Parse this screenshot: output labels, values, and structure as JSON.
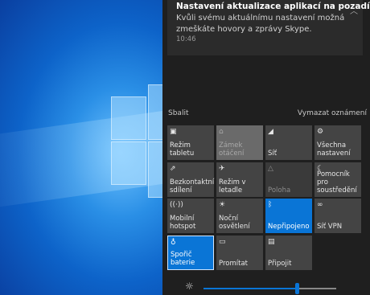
{
  "notification": {
    "title": "Nastavení aktualizace aplikací na pozadí",
    "body": "Kvůli svému aktuálnímu nastavení možná zmeškáte hovory a zprávy Skype.",
    "time": "10:46"
  },
  "collapse_label": "Sbalit",
  "clear_label": "Vymazat oznámení",
  "tiles": [
    {
      "label": "Režim tabletu",
      "icon": "tablet-icon",
      "state": "off"
    },
    {
      "label": "Zámek otáčení",
      "icon": "rotation-lock-icon",
      "state": "disabled"
    },
    {
      "label": "Síť",
      "icon": "network-icon",
      "state": "off"
    },
    {
      "label": "Všechna nastavení",
      "icon": "settings-icon",
      "state": "off"
    },
    {
      "label": "Bezkontaktní sdílení",
      "icon": "nearby-share-icon",
      "state": "off"
    },
    {
      "label": "Režim v letadle",
      "icon": "airplane-icon",
      "state": "off"
    },
    {
      "label": "Poloha",
      "icon": "location-icon",
      "state": "unavailable"
    },
    {
      "label": "Pomocník pro soustředění",
      "icon": "moon-icon",
      "state": "off"
    },
    {
      "label": "Mobilní hotspot",
      "icon": "hotspot-icon",
      "state": "off"
    },
    {
      "label": "Noční osvětlení",
      "icon": "brightness-icon",
      "state": "off"
    },
    {
      "label": "Nepřipojeno",
      "icon": "bluetooth-icon",
      "state": "on"
    },
    {
      "label": "Síť VPN",
      "icon": "vpn-icon",
      "state": "off"
    },
    {
      "label": "Spořič baterie",
      "icon": "battery-saver-icon",
      "state": "on-selected"
    },
    {
      "label": "Promítat",
      "icon": "project-icon",
      "state": "off"
    },
    {
      "label": "Připojit",
      "icon": "connect-icon",
      "state": "off"
    }
  ],
  "brightness": {
    "icon": "sun-icon",
    "level": 0.7
  },
  "colors": {
    "accent": "#0a75d6",
    "panel": "#1f1f1f",
    "tile": "#444444"
  }
}
